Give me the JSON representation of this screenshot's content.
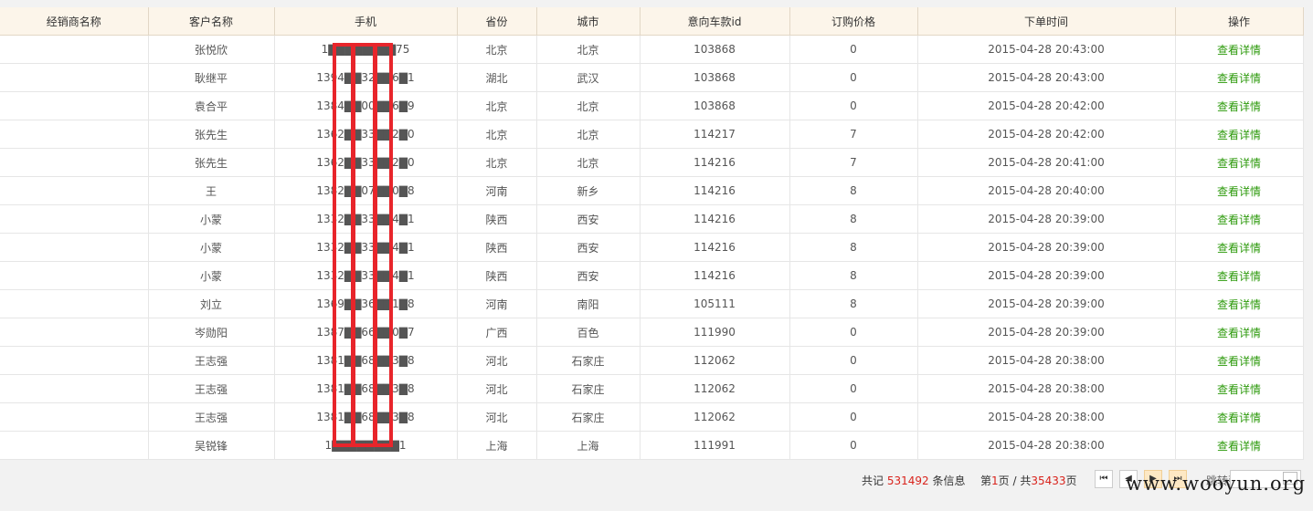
{
  "table": {
    "headers": [
      "经销商名称",
      "客户名称",
      "手机",
      "省份",
      "城市",
      "意向车款id",
      "订购价格",
      "下单时间",
      "操作"
    ],
    "rows": [
      {
        "dealer": "",
        "customer": "张悦欣",
        "phone": "1▇▇▇▇▇▇▇▇75",
        "province": "北京",
        "city": "北京",
        "car_id": "103868",
        "price": "0",
        "time": "2015-04-28 20:43:00",
        "action": "查看详情"
      },
      {
        "dealer": "",
        "customer": "耿继平",
        "phone": "1394▇▇32▇▇6▇1",
        "province": "湖北",
        "city": "武汉",
        "car_id": "103868",
        "price": "0",
        "time": "2015-04-28 20:43:00",
        "action": "查看详情"
      },
      {
        "dealer": "",
        "customer": "袁合平",
        "phone": "1384▇▇00▇▇6▇9",
        "province": "北京",
        "city": "北京",
        "car_id": "103868",
        "price": "0",
        "time": "2015-04-28 20:42:00",
        "action": "查看详情"
      },
      {
        "dealer": "",
        "customer": "张先生",
        "phone": "1362▇▇33▇▇2▇0",
        "province": "北京",
        "city": "北京",
        "car_id": "114217",
        "price": "7",
        "time": "2015-04-28 20:42:00",
        "action": "查看详情"
      },
      {
        "dealer": "",
        "customer": "张先生",
        "phone": "1362▇▇33▇▇2▇0",
        "province": "北京",
        "city": "北京",
        "car_id": "114216",
        "price": "7",
        "time": "2015-04-28 20:41:00",
        "action": "查看详情"
      },
      {
        "dealer": "",
        "customer": "王",
        "phone": "1382▇▇07▇▇0▇8",
        "province": "河南",
        "city": "新乡",
        "car_id": "114216",
        "price": "8",
        "time": "2015-04-28 20:40:00",
        "action": "查看详情"
      },
      {
        "dealer": "",
        "customer": "小蒙",
        "phone": "1332▇▇33▇▇4▇1",
        "province": "陕西",
        "city": "西安",
        "car_id": "114216",
        "price": "8",
        "time": "2015-04-28 20:39:00",
        "action": "查看详情"
      },
      {
        "dealer": "",
        "customer": "小蒙",
        "phone": "1332▇▇33▇▇4▇1",
        "province": "陕西",
        "city": "西安",
        "car_id": "114216",
        "price": "8",
        "time": "2015-04-28 20:39:00",
        "action": "查看详情"
      },
      {
        "dealer": "",
        "customer": "小蒙",
        "phone": "1332▇▇33▇▇4▇1",
        "province": "陕西",
        "city": "西安",
        "car_id": "114216",
        "price": "8",
        "time": "2015-04-28 20:39:00",
        "action": "查看详情"
      },
      {
        "dealer": "",
        "customer": "刘立",
        "phone": "1369▇▇36▇▇1▇8",
        "province": "河南",
        "city": "南阳",
        "car_id": "105111",
        "price": "8",
        "time": "2015-04-28 20:39:00",
        "action": "查看详情"
      },
      {
        "dealer": "",
        "customer": "岑勋阳",
        "phone": "1387▇▇66▇▇0▇7",
        "province": "广西",
        "city": "百色",
        "car_id": "111990",
        "price": "0",
        "time": "2015-04-28 20:39:00",
        "action": "查看详情"
      },
      {
        "dealer": "",
        "customer": "王志强",
        "phone": "1381▇▇68▇▇3▇8",
        "province": "河北",
        "city": "石家庄",
        "car_id": "112062",
        "price": "0",
        "time": "2015-04-28 20:38:00",
        "action": "查看详情"
      },
      {
        "dealer": "",
        "customer": "王志强",
        "phone": "1381▇▇68▇▇3▇8",
        "province": "河北",
        "city": "石家庄",
        "car_id": "112062",
        "price": "0",
        "time": "2015-04-28 20:38:00",
        "action": "查看详情"
      },
      {
        "dealer": "",
        "customer": "王志强",
        "phone": "1381▇▇68▇▇3▇8",
        "province": "河北",
        "city": "石家庄",
        "car_id": "112062",
        "price": "0",
        "time": "2015-04-28 20:38:00",
        "action": "查看详情"
      },
      {
        "dealer": "",
        "customer": "吴锐锋",
        "phone": "1▇▇▇▇▇▇▇▇1",
        "province": "上海",
        "city": "上海",
        "car_id": "111991",
        "price": "0",
        "time": "2015-04-28 20:38:00",
        "action": "查看详情"
      }
    ]
  },
  "pager": {
    "total_prefix": "共记",
    "total_count": "531492",
    "total_suffix": "条信息",
    "page_prefix": "第",
    "current_page": "1",
    "page_mid": "页 / 共",
    "total_pages": "35433",
    "page_suffix": "页",
    "jump_label": "跳转到",
    "first_icon": "first-page-icon",
    "prev_icon": "prev-page-icon",
    "next_icon": "next-page-icon",
    "last_icon": "last-page-icon"
  },
  "watermark": "www.wooyun.org",
  "colors": {
    "header_bg": "#fcf5ea",
    "action_link": "#2d9a0c",
    "highlight": "#d9231c",
    "redaction": "#e8252b"
  }
}
